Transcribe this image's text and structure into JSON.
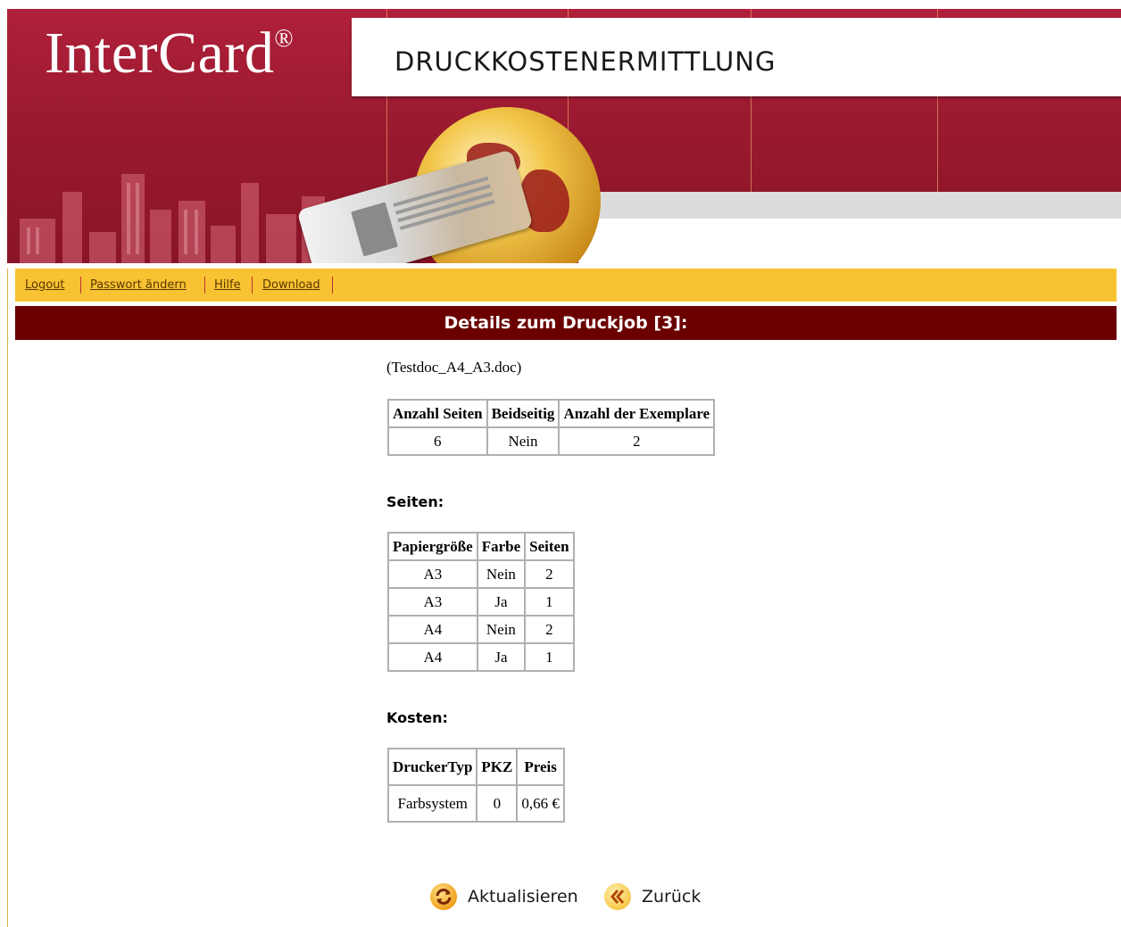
{
  "header": {
    "brand": "InterCard",
    "brand_mark": "®",
    "title": "DRUCKKOSTENERMITTLUNG"
  },
  "nav": {
    "items": [
      {
        "label": "Logout"
      },
      {
        "label": "Passwort ändern"
      },
      {
        "label": "Hilfe"
      },
      {
        "label": "Download"
      }
    ]
  },
  "section": {
    "title": "Details zum Druckjob [3]:"
  },
  "job": {
    "filename": "(Testdoc_A4_A3.doc)",
    "summary": {
      "headers": [
        "Anzahl Seiten",
        "Beidseitig",
        "Anzahl der Exemplare"
      ],
      "row": [
        "6",
        "Nein",
        "2"
      ]
    }
  },
  "pages": {
    "heading": "Seiten:",
    "headers": [
      "Papiergröße",
      "Farbe",
      "Seiten"
    ],
    "rows": [
      [
        "A3",
        "Nein",
        "2"
      ],
      [
        "A3",
        "Ja",
        "1"
      ],
      [
        "A4",
        "Nein",
        "2"
      ],
      [
        "A4",
        "Ja",
        "1"
      ]
    ]
  },
  "costs": {
    "heading": "Kosten:",
    "headers": [
      "DruckerTyp",
      "PKZ",
      "Preis"
    ],
    "row": [
      "Farbsystem",
      "0",
      "0,66 €"
    ]
  },
  "buttons": {
    "refresh": "Aktualisieren",
    "back": "Zurück"
  },
  "colors": {
    "banner": "#9a1a30",
    "navbar": "#f8c232",
    "section_header": "#6b0000"
  },
  "icons": {
    "refresh": "refresh-icon",
    "back": "back-chevrons-icon"
  }
}
